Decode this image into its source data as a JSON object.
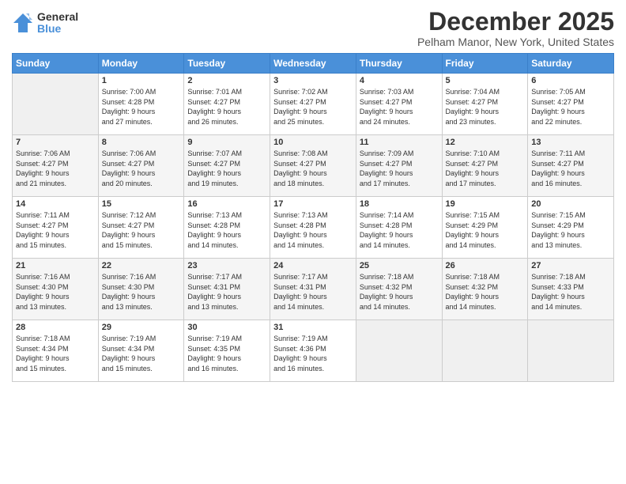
{
  "logo": {
    "general": "General",
    "blue": "Blue"
  },
  "title": "December 2025",
  "location": "Pelham Manor, New York, United States",
  "days_of_week": [
    "Sunday",
    "Monday",
    "Tuesday",
    "Wednesday",
    "Thursday",
    "Friday",
    "Saturday"
  ],
  "weeks": [
    [
      {
        "num": "",
        "info": ""
      },
      {
        "num": "1",
        "info": "Sunrise: 7:00 AM\nSunset: 4:28 PM\nDaylight: 9 hours\nand 27 minutes."
      },
      {
        "num": "2",
        "info": "Sunrise: 7:01 AM\nSunset: 4:27 PM\nDaylight: 9 hours\nand 26 minutes."
      },
      {
        "num": "3",
        "info": "Sunrise: 7:02 AM\nSunset: 4:27 PM\nDaylight: 9 hours\nand 25 minutes."
      },
      {
        "num": "4",
        "info": "Sunrise: 7:03 AM\nSunset: 4:27 PM\nDaylight: 9 hours\nand 24 minutes."
      },
      {
        "num": "5",
        "info": "Sunrise: 7:04 AM\nSunset: 4:27 PM\nDaylight: 9 hours\nand 23 minutes."
      },
      {
        "num": "6",
        "info": "Sunrise: 7:05 AM\nSunset: 4:27 PM\nDaylight: 9 hours\nand 22 minutes."
      }
    ],
    [
      {
        "num": "7",
        "info": "Sunrise: 7:06 AM\nSunset: 4:27 PM\nDaylight: 9 hours\nand 21 minutes."
      },
      {
        "num": "8",
        "info": "Sunrise: 7:06 AM\nSunset: 4:27 PM\nDaylight: 9 hours\nand 20 minutes."
      },
      {
        "num": "9",
        "info": "Sunrise: 7:07 AM\nSunset: 4:27 PM\nDaylight: 9 hours\nand 19 minutes."
      },
      {
        "num": "10",
        "info": "Sunrise: 7:08 AM\nSunset: 4:27 PM\nDaylight: 9 hours\nand 18 minutes."
      },
      {
        "num": "11",
        "info": "Sunrise: 7:09 AM\nSunset: 4:27 PM\nDaylight: 9 hours\nand 17 minutes."
      },
      {
        "num": "12",
        "info": "Sunrise: 7:10 AM\nSunset: 4:27 PM\nDaylight: 9 hours\nand 17 minutes."
      },
      {
        "num": "13",
        "info": "Sunrise: 7:11 AM\nSunset: 4:27 PM\nDaylight: 9 hours\nand 16 minutes."
      }
    ],
    [
      {
        "num": "14",
        "info": "Sunrise: 7:11 AM\nSunset: 4:27 PM\nDaylight: 9 hours\nand 15 minutes."
      },
      {
        "num": "15",
        "info": "Sunrise: 7:12 AM\nSunset: 4:27 PM\nDaylight: 9 hours\nand 15 minutes."
      },
      {
        "num": "16",
        "info": "Sunrise: 7:13 AM\nSunset: 4:28 PM\nDaylight: 9 hours\nand 14 minutes."
      },
      {
        "num": "17",
        "info": "Sunrise: 7:13 AM\nSunset: 4:28 PM\nDaylight: 9 hours\nand 14 minutes."
      },
      {
        "num": "18",
        "info": "Sunrise: 7:14 AM\nSunset: 4:28 PM\nDaylight: 9 hours\nand 14 minutes."
      },
      {
        "num": "19",
        "info": "Sunrise: 7:15 AM\nSunset: 4:29 PM\nDaylight: 9 hours\nand 14 minutes."
      },
      {
        "num": "20",
        "info": "Sunrise: 7:15 AM\nSunset: 4:29 PM\nDaylight: 9 hours\nand 13 minutes."
      }
    ],
    [
      {
        "num": "21",
        "info": "Sunrise: 7:16 AM\nSunset: 4:30 PM\nDaylight: 9 hours\nand 13 minutes."
      },
      {
        "num": "22",
        "info": "Sunrise: 7:16 AM\nSunset: 4:30 PM\nDaylight: 9 hours\nand 13 minutes."
      },
      {
        "num": "23",
        "info": "Sunrise: 7:17 AM\nSunset: 4:31 PM\nDaylight: 9 hours\nand 13 minutes."
      },
      {
        "num": "24",
        "info": "Sunrise: 7:17 AM\nSunset: 4:31 PM\nDaylight: 9 hours\nand 14 minutes."
      },
      {
        "num": "25",
        "info": "Sunrise: 7:18 AM\nSunset: 4:32 PM\nDaylight: 9 hours\nand 14 minutes."
      },
      {
        "num": "26",
        "info": "Sunrise: 7:18 AM\nSunset: 4:32 PM\nDaylight: 9 hours\nand 14 minutes."
      },
      {
        "num": "27",
        "info": "Sunrise: 7:18 AM\nSunset: 4:33 PM\nDaylight: 9 hours\nand 14 minutes."
      }
    ],
    [
      {
        "num": "28",
        "info": "Sunrise: 7:18 AM\nSunset: 4:34 PM\nDaylight: 9 hours\nand 15 minutes."
      },
      {
        "num": "29",
        "info": "Sunrise: 7:19 AM\nSunset: 4:34 PM\nDaylight: 9 hours\nand 15 minutes."
      },
      {
        "num": "30",
        "info": "Sunrise: 7:19 AM\nSunset: 4:35 PM\nDaylight: 9 hours\nand 16 minutes."
      },
      {
        "num": "31",
        "info": "Sunrise: 7:19 AM\nSunset: 4:36 PM\nDaylight: 9 hours\nand 16 minutes."
      },
      {
        "num": "",
        "info": ""
      },
      {
        "num": "",
        "info": ""
      },
      {
        "num": "",
        "info": ""
      }
    ]
  ]
}
